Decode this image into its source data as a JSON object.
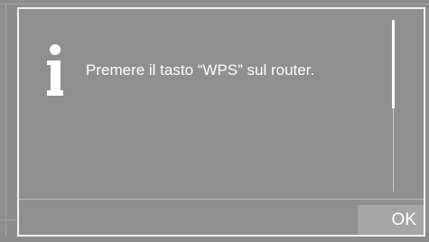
{
  "dialog": {
    "message": "Premere il tasto “WPS” sul router.",
    "icon": "info-icon",
    "ok_label": "OK"
  },
  "colors": {
    "background": "#8d8d8d",
    "dialog_border": "#f2f2f2",
    "text": "#ffffff",
    "button": "#a6a6a6"
  }
}
